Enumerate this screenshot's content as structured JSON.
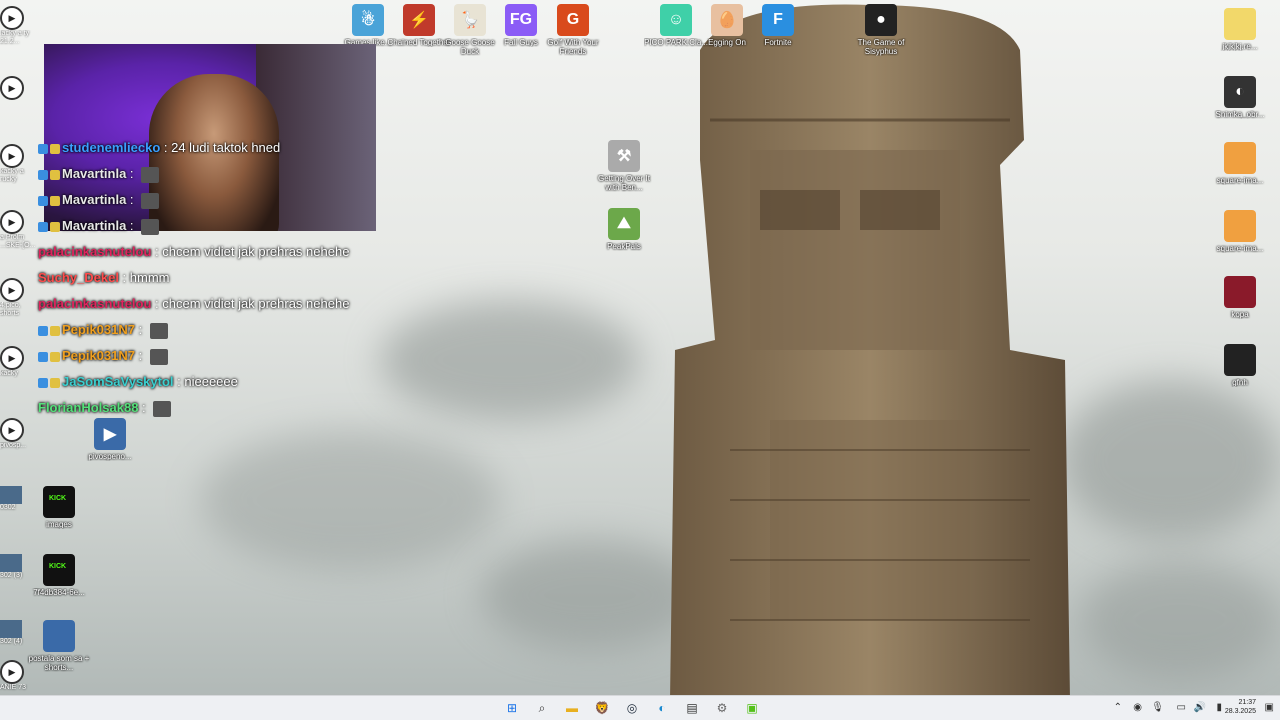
{
  "desktop_icons_top": [
    {
      "name": "Getting Over It",
      "label": "Games like...",
      "icon": "game-icon",
      "color": "#4aa3d8"
    },
    {
      "name": "Chained Together",
      "label": "Chained Together",
      "icon": "game-icon",
      "color": "#c03a2b"
    },
    {
      "name": "Goose Goose Duck",
      "label": "Goose Goose Duck",
      "icon": "goose-icon",
      "color": "#e8e3d4"
    },
    {
      "name": "Fall Guys",
      "label": "Fall Guys",
      "icon": "game-icon",
      "color": "#8b5cf6"
    },
    {
      "name": "Golf With Your Friends",
      "label": "Golf With Your Friends",
      "icon": "game-icon",
      "color": "#d94a1c"
    },
    {
      "name": "PICO PARK",
      "label": "PICO PARK:Cla...",
      "icon": "game-icon",
      "color": "#3fd0a8"
    },
    {
      "name": "Egging On",
      "label": "Egging On",
      "icon": "egg-icon",
      "color": "#e8c0a0"
    },
    {
      "name": "Fortnite",
      "label": "Fortnite",
      "icon": "game-icon",
      "color": "#2a8fe0"
    },
    {
      "name": "The Game of Sisyphus",
      "label": "The Game of Sisyphus",
      "icon": "game-icon",
      "color": "#222"
    }
  ],
  "desktop_icons_mid": [
    {
      "label": "Getting Over It with Ben...",
      "icon": "hammer-icon",
      "color": "#aaa"
    },
    {
      "label": "PeakPals",
      "icon": "game-icon",
      "color": "#6ca84a"
    }
  ],
  "desktop_icons_right": [
    {
      "label": "jkjkjkj.re...",
      "icon": "file-icon",
      "color": "#f2d86a"
    },
    {
      "label": "Snimka_obr...",
      "icon": "image-icon",
      "color": "#333"
    },
    {
      "label": "square-ima...",
      "icon": "image-icon",
      "color": "#f0a040"
    },
    {
      "label": "square-ima...",
      "icon": "image-icon",
      "color": "#f0a040"
    },
    {
      "label": "kopa",
      "icon": "image-icon",
      "color": "#8a1a2a"
    },
    {
      "label": "gfnh",
      "icon": "image-icon",
      "color": "#222"
    }
  ],
  "desktop_icons_left": [
    {
      "label": "pivospeno...",
      "icon": "video-icon"
    },
    {
      "label": "images",
      "icon": "image-icon",
      "badge": "KICK"
    },
    {
      "label": "7f4db384-6e...",
      "icon": "image-icon",
      "badge": "KICK"
    },
    {
      "label": "postala som sa + shorts...",
      "icon": "image-icon"
    }
  ],
  "left_cut_labels": [
    "lacky a ty 21.2...",
    "",
    "kácky a rucky",
    "a Prôlm ...SKE-[O...",
    "4.pico, shorts",
    "kácky",
    "pivosp...",
    "0302",
    "302 (3)",
    "302 (4)",
    "ANIE 73"
  ],
  "chat": [
    {
      "user": "studenemliecko",
      "user_color": "#3aa0ff",
      "sep": " : ",
      "msg": "24 ludi taktok hned"
    },
    {
      "user": "Mavartinla",
      "user_color": "#e8e8e8",
      "sep": " : ",
      "msg": ""
    },
    {
      "user": "Mavartinla",
      "user_color": "#e8e8e8",
      "sep": " : ",
      "msg": ""
    },
    {
      "user": "Mavartinla",
      "user_color": "#e8e8e8",
      "sep": " : ",
      "msg": ""
    },
    {
      "user": "palacinkasnutelou",
      "user_color": "#e0245e",
      "sep": " : ",
      "msg": "chcem vidiet jak prehras nehehe"
    },
    {
      "user": "Suchy_Dekel",
      "user_color": "#ff4d4d",
      "sep": " : ",
      "msg": "hmmm"
    },
    {
      "user": "palacinkasnutelou",
      "user_color": "#e0245e",
      "sep": " : ",
      "msg": "chcem vidiet jak prehras nehehe"
    },
    {
      "user": "Pepik031N7",
      "user_color": "#f0a020",
      "sep": " : ",
      "msg": ""
    },
    {
      "user": "Pepik031N7",
      "user_color": "#f0a020",
      "sep": " : ",
      "msg": ""
    },
    {
      "user": "JaSomSaVyskytol",
      "user_color": "#3ad0d0",
      "sep": " : ",
      "msg": "nieeeeee"
    },
    {
      "user": "FlorianHolsak88",
      "user_color": "#55e07a",
      "sep": " : ",
      "msg": ""
    }
  ],
  "taskbar": {
    "apps": [
      "windows-start-icon",
      "search-icon",
      "file-explorer-icon",
      "brave-icon",
      "steam-icon",
      "edge-icon",
      "app-icon",
      "settings-icon",
      "kick-icon"
    ],
    "clock_time": "21:37",
    "clock_date": "28.3.2025"
  }
}
